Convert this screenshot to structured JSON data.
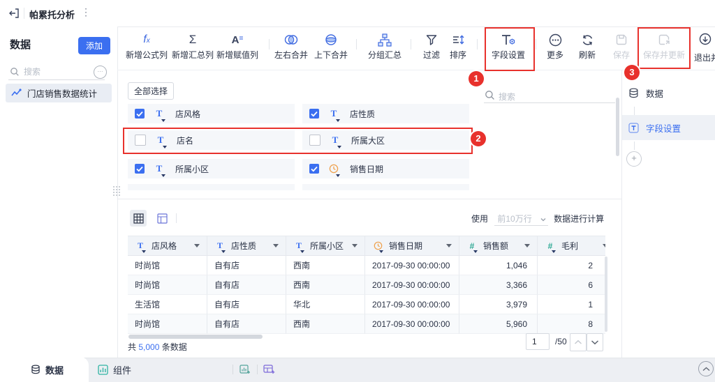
{
  "topbar": {
    "title": "帕累托分析"
  },
  "left_sidebar": {
    "heading": "数据",
    "add_button": "添加",
    "search_placeholder": "搜索",
    "dataset": "门店销售数据统计"
  },
  "toolbar": {
    "new_formula": "新增公式列",
    "new_summary": "新增汇总列",
    "new_assign": "新增赋值列",
    "merge_lr": "左右合并",
    "merge_tb": "上下合并",
    "group_summary": "分组汇总",
    "filter": "过滤",
    "sort": "排序",
    "field_settings": "字段设置",
    "more": "更多",
    "refresh": "刷新",
    "save": "保存",
    "save_update": "保存并更新",
    "exit": "退出并预览"
  },
  "glyphs": {
    "f": "f",
    "x": "x",
    "sigma": "Σ",
    "a": "A",
    "eq": "=",
    "t": "T",
    "hash": "#",
    "plus": "+",
    "dots": "⋮",
    "ellipsis": "···"
  },
  "field_panel": {
    "select_all": "全部选择",
    "search_placeholder": "搜索",
    "fields": [
      {
        "label": "店风格",
        "checked": true,
        "type": "text"
      },
      {
        "label": "店性质",
        "checked": true,
        "type": "text"
      },
      {
        "label": "店名",
        "checked": false,
        "type": "text"
      },
      {
        "label": "所属大区",
        "checked": false,
        "type": "text"
      },
      {
        "label": "所属小区",
        "checked": true,
        "type": "text"
      },
      {
        "label": "销售日期",
        "checked": true,
        "type": "date"
      }
    ]
  },
  "right_panel": {
    "data": "数据",
    "field_settings": "字段设置"
  },
  "table": {
    "usage_prefix": "使用",
    "usage_dropdown": "前10万行",
    "usage_suffix": "数据进行计算",
    "columns": [
      {
        "label": "店风格",
        "type": "text"
      },
      {
        "label": "店性质",
        "type": "text"
      },
      {
        "label": "所属小区",
        "type": "text"
      },
      {
        "label": "销售日期",
        "type": "date"
      },
      {
        "label": "销售额",
        "type": "number"
      },
      {
        "label": "毛利",
        "type": "number"
      }
    ],
    "rows": [
      [
        "时尚馆",
        "自有店",
        "西南",
        "2017-09-30 00:00:00",
        "1,046",
        "2"
      ],
      [
        "时尚馆",
        "自有店",
        "西南",
        "2017-09-30 00:00:00",
        "3,366",
        "6"
      ],
      [
        "生活馆",
        "自有店",
        "华北",
        "2017-09-30 00:00:00",
        "3,979",
        "1"
      ],
      [
        "时尚馆",
        "自有店",
        "西南",
        "2017-09-30 00:00:00",
        "5,960",
        "8"
      ]
    ],
    "total_prefix": "共",
    "total_count": "5,000",
    "total_suffix": "条数据",
    "page_value": "1",
    "page_total": "/50"
  },
  "bottom_bar": {
    "tab_data": "数据",
    "tab_component": "组件"
  },
  "annotations": {
    "badge_1": "1",
    "badge_2": "2",
    "badge_3": "3"
  },
  "colors": {
    "accent": "#3b6ff0",
    "annotation_red": "#e8312c"
  }
}
